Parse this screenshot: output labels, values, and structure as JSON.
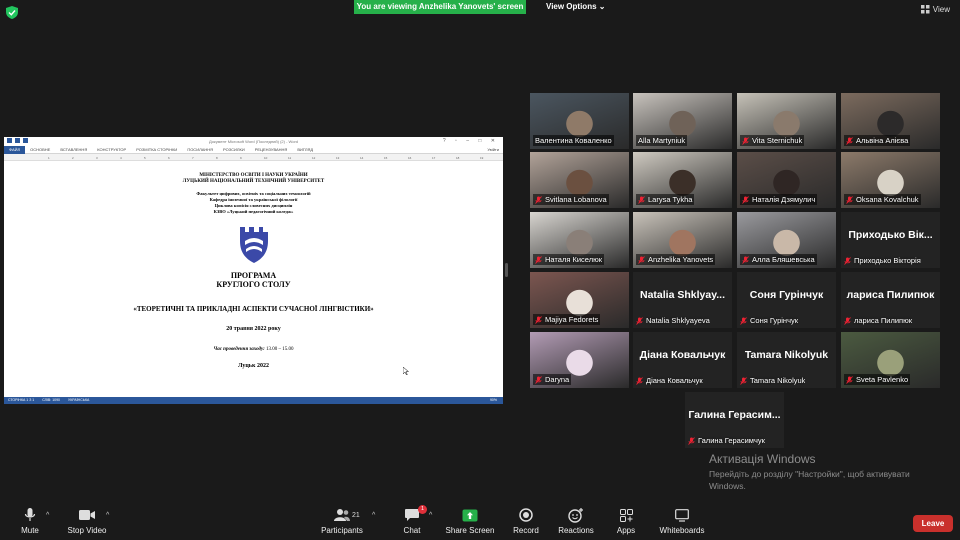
{
  "topbar": {
    "banner": "You are viewing Anzhelika Yanovets' screen",
    "view_options": "View Options",
    "view": "View",
    "colors": {
      "banner": "#26b04a"
    }
  },
  "shared_doc": {
    "window_title": "Документ Microsoft Word (Последний) (2) - Word",
    "ribbon_tabs": [
      "ФАЙЛ",
      "ОСНОВНЕ",
      "ВСТАВЛЕННЯ",
      "КОНСТРУКТОР",
      "РОЗМІТКА СТОРІНКИ",
      "ПОСИЛАННЯ",
      "РОЗСИЛКИ",
      "РЕЦЕНЗУВАННЯ",
      "ВИГЛЯД"
    ],
    "login": "Увійти",
    "lines": {
      "ministry": "МІНІСТЕРСТВО ОСВІТИ І НАУКИ УКРАЇНИ",
      "university": "ЛУЦЬКИЙ НАЦІОНАЛЬНИЙ ТЕХНІЧНИЙ УНІВЕРСИТЕТ",
      "faculty": "Факультет цифрових, освітніх та соціальних технологій",
      "dept": "Кафедра іноземної та української філології",
      "commission": "Циклова комісія словесних дисциплін",
      "college": "КЗВО «Луцький педагогічний коледж»",
      "program": "ПРОГРАМА",
      "round_table": "КРУГЛОГО СТОЛУ",
      "theme": "«ТЕОРЕТИЧНІ ТА ПРИКЛАДНІ АСПЕКТИ СУЧАСНОЇ ЛІНГВІСТИКИ»",
      "date": "20 травня 2022 року",
      "time_label": "Час проведення заходу:",
      "time_value": " 13.00 – 15.00",
      "city": "Луцьк 2022"
    },
    "status_left": "СТОРІНКА 1 З 1",
    "status_words": "СЛІВ: 1090",
    "status_lang": "УКРАЇНСЬКА",
    "zoom": "90%"
  },
  "participants": [
    {
      "name": "Валентина Коваленко",
      "muted": false,
      "video": true
    },
    {
      "name": "Alla Martyniuk",
      "muted": false,
      "video": true
    },
    {
      "name": "Vita Sternichuk",
      "muted": true,
      "video": true
    },
    {
      "name": "Альвіна Алієва",
      "muted": true,
      "video": true
    },
    {
      "name": "Svitlana Lobanova",
      "muted": true,
      "video": true
    },
    {
      "name": "Larysa Tykha",
      "muted": true,
      "video": true
    },
    {
      "name": "Наталія Дзямулич",
      "muted": true,
      "video": true
    },
    {
      "name": "Oksana Kovalchuk",
      "muted": true,
      "video": true
    },
    {
      "name": "Наталя Киселюк",
      "muted": true,
      "video": true
    },
    {
      "name": "Anzhelika Yanovets",
      "muted": true,
      "video": true,
      "active": true
    },
    {
      "name": "Алла Бляшевська",
      "muted": true,
      "video": true
    },
    {
      "name": "Приходько Вікторія",
      "big": "Приходько Вік...",
      "muted": true,
      "video": false
    },
    {
      "name": "Majiya Fedorets",
      "muted": true,
      "video": true
    },
    {
      "name": "Natalia Shklyayeva",
      "big": "Natalia  Shklyay...",
      "muted": true,
      "video": false
    },
    {
      "name": "Соня Гурінчук",
      "big": "Соня Гурінчук",
      "muted": true,
      "video": false
    },
    {
      "name": "лариса Пилипюк",
      "big": "лариса Пилипюк",
      "muted": true,
      "video": false
    },
    {
      "name": "Daryna",
      "muted": true,
      "video": true
    },
    {
      "name": "Діана Ковальчук",
      "big": "Діана Ковальчук",
      "muted": true,
      "video": false
    },
    {
      "name": "Tamara Nikolyuk",
      "big": "Tamara Nikolyuk",
      "muted": true,
      "video": false
    },
    {
      "name": "Sveta Pavlenko",
      "muted": true,
      "video": true
    },
    {
      "name": "Галина Герасимчук",
      "big": "Галина  Герасим...",
      "muted": true,
      "video": false
    }
  ],
  "watermark": {
    "title": "Активація Windows",
    "body": "Перейдіть до розділу \"Настройки\", щоб активувати Windows."
  },
  "toolbar": {
    "mute": "Mute",
    "stop_video": "Stop Video",
    "participants": "Participants",
    "participants_count": "21",
    "chat": "Chat",
    "chat_badge": "1",
    "share_screen": "Share Screen",
    "record": "Record",
    "reactions": "Reactions",
    "apps": "Apps",
    "whiteboards": "Whiteboards",
    "leave": "Leave",
    "colors": {
      "leave": "#c9302c",
      "share": "#26b04a"
    }
  }
}
